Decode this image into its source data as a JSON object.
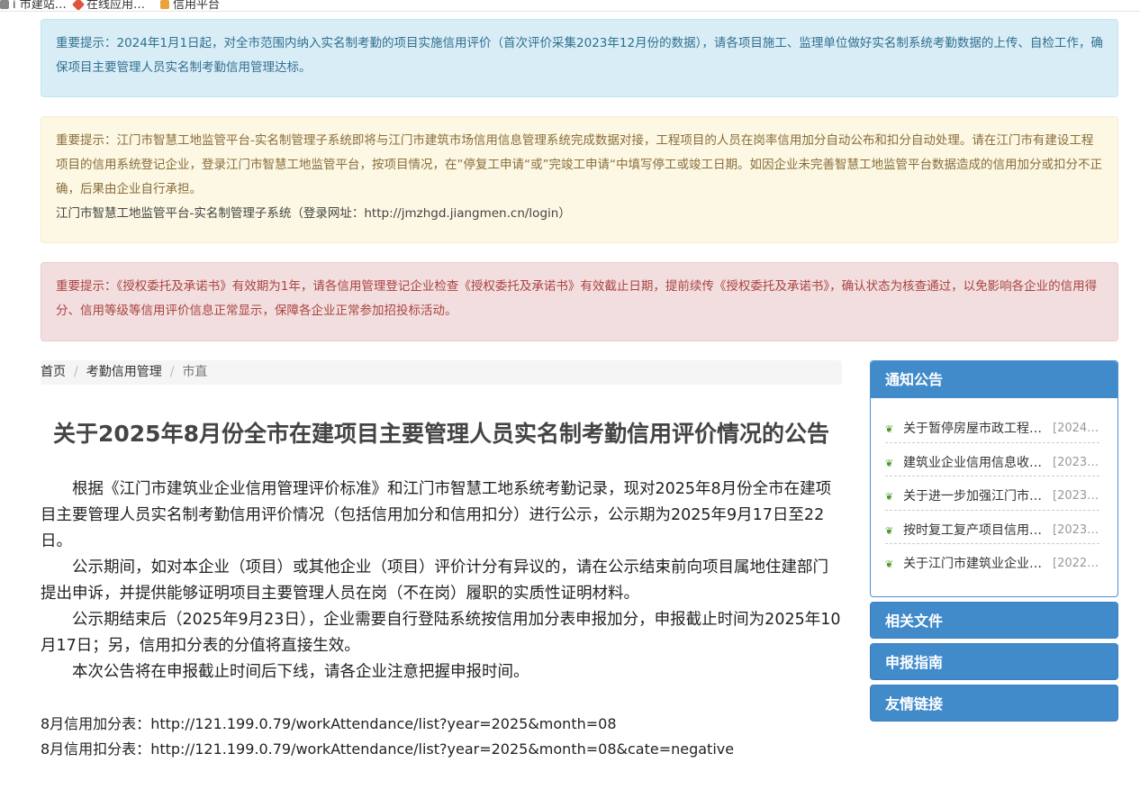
{
  "browser": {
    "bookmarks": [
      {
        "label": "i 市建站…",
        "icon": "globe-icon",
        "color": "#888888"
      },
      {
        "label": "在线应用…",
        "icon": "diamond-icon",
        "color": "#e0533d"
      },
      {
        "label": "信用平台",
        "icon": "folder-icon",
        "color": "#e8a33b"
      }
    ]
  },
  "alerts": {
    "info": "重要提示：2024年1月1日起，对全市范围内纳入实名制考勤的项目实施信用评价（首次评价采集2023年12月份的数据），请各项目施工、监理单位做好实名制系统考勤数据的上传、自检工作，确保项目主要管理人员实名制考勤信用管理达标。",
    "warning": "重要提示：江门市智慧工地监管平台-实名制管理子系统即将与江门市建筑市场信用信息管理系统完成数据对接，工程项目的人员在岗率信用加分自动公布和扣分自动处理。请在江门市有建设工程项目的信用系统登记企业，登录江门市智慧工地监管平台，按项目情况，在”停复工申请“或”完竣工申请“中填写停工或竣工日期。如因企业未完善智慧工地监管平台数据造成的信用加分或扣分不正确，后果由企业自行承担。",
    "warning_site": "江门市智慧工地监管平台-实名制管理子系统（登录网址：http://jmzhgd.jiangmen.cn/login）",
    "danger": "重要提示：《授权委托及承诺书》有效期为1年，请各信用管理登记企业检查《授权委托及承诺书》有效截止日期，提前续传《授权委托及承诺书》，确认状态为核查通过，以免影响各企业的信用得分、信用等级等信用评价信息正常显示，保障各企业正常参加招投标活动。",
    "colors": {
      "info_bg": "#d9edf7",
      "warning_bg": "#fcf8e3",
      "danger_bg": "#f2dede"
    }
  },
  "breadcrumb": {
    "home": "首页",
    "section": "考勤信用管理",
    "current": "市直",
    "separator": "/"
  },
  "article": {
    "title": "关于2025年8月份全市在建项目主要管理人员实名制考勤信用评价情况的公告",
    "paragraphs": [
      "根据《江门市建筑业企业信用管理评价标准》和江门市智慧工地系统考勤记录，现对2025年8月份全市在建项目主要管理人员实名制考勤信用评价情况（包括信用加分和信用扣分）进行公示，公示期为2025年9月17日至22日。",
      "公示期间，如对本企业（项目）或其他企业（项目）评价计分有异议的，请在公示结束前向项目属地住建部门提出申诉，并提供能够证明项目主要管理人员在岗（不在岗）履职的实质性证明材料。",
      "公示期结束后（2025年9月23日），企业需要自行登陆系统按信用加分表申报加分，申报截止时间为2025年10月17日；另，信用扣分表的分值将直接生效。",
      "本次公告将在申报截止时间后下线，请各企业注意把握申报时间。"
    ],
    "links": [
      {
        "label": "8月信用加分表：",
        "url": "http://121.199.0.79/workAttendance/list?year=2025&month=08"
      },
      {
        "label": "8月信用扣分表：",
        "url": "http://121.199.0.79/workAttendance/list?year=2025&month=08&cate=negative"
      }
    ]
  },
  "sidebar": {
    "notice": {
      "heading": "通知公告",
      "items": [
        {
          "title": "关于暂停房屋市政工程…",
          "date": "[2024-…"
        },
        {
          "title": "建筑业企业信用信息收…",
          "date": "[2023-…"
        },
        {
          "title": "关于进一步加强江门市…",
          "date": "[2023-…"
        },
        {
          "title": "按时复工复产项目信用…",
          "date": "[2023-…"
        },
        {
          "title": "关于江门市建筑业企业…",
          "date": "[2022-…"
        }
      ]
    },
    "files_heading": "相关文件",
    "guide_heading": "申报指南",
    "links_heading": "友情链接",
    "accent": "#428bca"
  }
}
